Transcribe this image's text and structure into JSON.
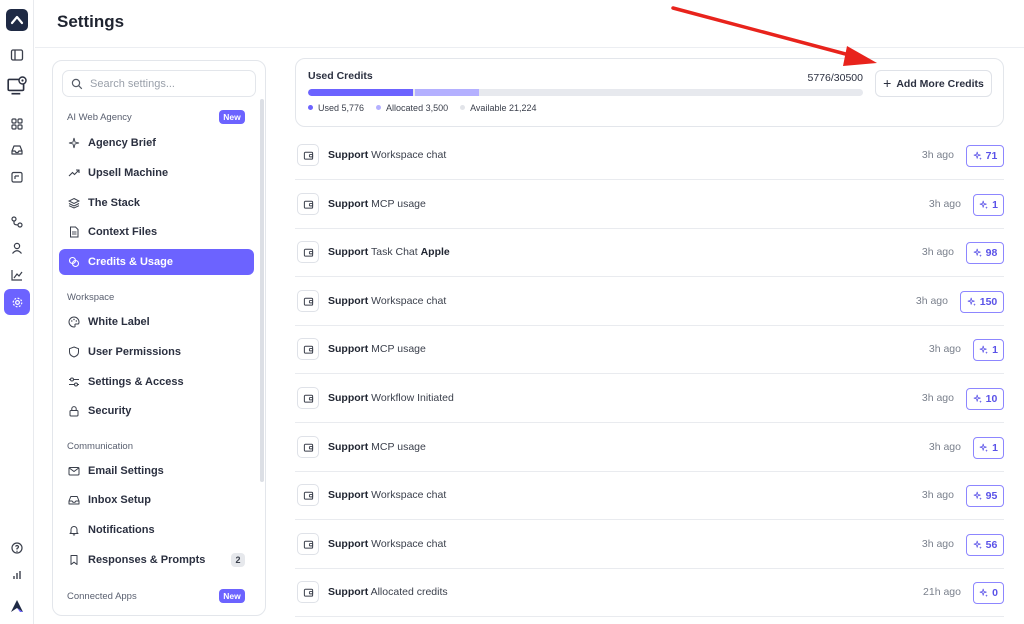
{
  "header": {
    "title": "Settings"
  },
  "rail": {
    "icons": [
      "app-logo",
      "sidebar-toggle-icon",
      "computer-settings-icon",
      "grid-icon",
      "inbox-icon",
      "calendar-icon",
      "workflow-icon",
      "user-icon",
      "chart-icon",
      "settings-icon",
      "help-icon",
      "stats-icon",
      "brand-logo"
    ],
    "active": "settings-icon"
  },
  "settings_nav": {
    "search_placeholder": "Search settings...",
    "sections": [
      {
        "label": "AI Web Agency",
        "badge": "New",
        "items": [
          {
            "label": "Agency Brief",
            "icon": "sparkle-icon"
          },
          {
            "label": "Upsell Machine",
            "icon": "trend-up-icon"
          },
          {
            "label": "The Stack",
            "icon": "layers-icon"
          },
          {
            "label": "Context Files",
            "icon": "file-icon"
          },
          {
            "label": "Credits & Usage",
            "icon": "coins-icon",
            "active": true
          }
        ]
      },
      {
        "label": "Workspace",
        "items": [
          {
            "label": "White Label",
            "icon": "palette-icon"
          },
          {
            "label": "User Permissions",
            "icon": "shield-icon"
          },
          {
            "label": "Settings & Access",
            "icon": "sliders-icon"
          },
          {
            "label": "Security",
            "icon": "lock-icon"
          }
        ]
      },
      {
        "label": "Communication",
        "items": [
          {
            "label": "Email Settings",
            "icon": "mail-icon"
          },
          {
            "label": "Inbox Setup",
            "icon": "inbox-icon"
          },
          {
            "label": "Notifications",
            "icon": "bell-icon"
          },
          {
            "label": "Responses & Prompts",
            "icon": "bookmark-icon",
            "count": "2"
          }
        ]
      },
      {
        "label": "Connected Apps",
        "badge": "New",
        "items": []
      }
    ]
  },
  "credits": {
    "title": "Used Credits",
    "count_text": "5776/30500",
    "used": 5776,
    "allocated": 3500,
    "total": 30500,
    "legend": {
      "used": "Used 5,776",
      "allocated": "Allocated 3,500",
      "available": "Available 21,224"
    },
    "add_button": "Add More Credits",
    "colors": {
      "used": "#6c63ff",
      "allocated": "#b4b0ff",
      "available": "#e7e9ee"
    }
  },
  "usage": [
    {
      "who": "Support",
      "what": "Workspace chat",
      "extra": "",
      "time": "3h ago",
      "credits": "71"
    },
    {
      "who": "Support",
      "what": "MCP usage",
      "extra": "",
      "time": "3h ago",
      "credits": "1"
    },
    {
      "who": "Support",
      "what": "Task Chat",
      "extra": "Apple",
      "time": "3h ago",
      "credits": "98"
    },
    {
      "who": "Support",
      "what": "Workspace chat",
      "extra": "",
      "time": "3h ago",
      "credits": "150"
    },
    {
      "who": "Support",
      "what": "MCP usage",
      "extra": "",
      "time": "3h ago",
      "credits": "1"
    },
    {
      "who": "Support",
      "what": "Workflow Initiated",
      "extra": "",
      "time": "3h ago",
      "credits": "10"
    },
    {
      "who": "Support",
      "what": "MCP usage",
      "extra": "",
      "time": "3h ago",
      "credits": "1"
    },
    {
      "who": "Support",
      "what": "Workspace chat",
      "extra": "",
      "time": "3h ago",
      "credits": "95"
    },
    {
      "who": "Support",
      "what": "Workspace chat",
      "extra": "",
      "time": "3h ago",
      "credits": "56"
    },
    {
      "who": "Support",
      "what": "Allocated credits",
      "extra": "",
      "time": "21h ago",
      "credits": "0"
    }
  ]
}
